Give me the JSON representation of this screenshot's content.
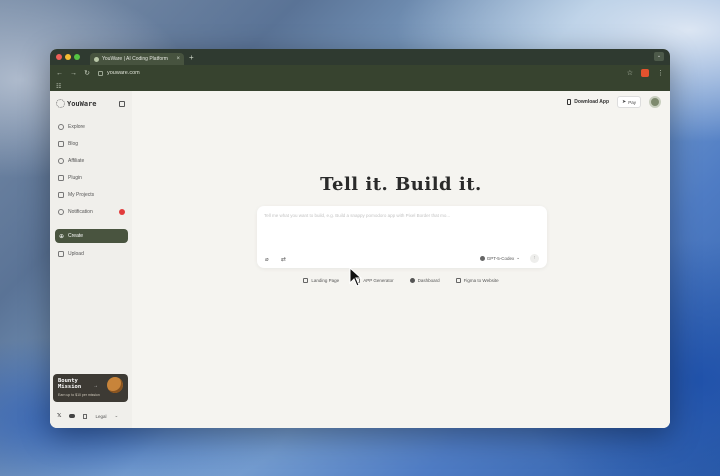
{
  "browser": {
    "tab_title": "YouWare | AI Coding Platform",
    "url": "youware.com"
  },
  "sidebar": {
    "brand": "YouWare",
    "items": [
      {
        "label": "Explore",
        "icon": "compass-icon"
      },
      {
        "label": "Blog",
        "icon": "book-icon"
      },
      {
        "label": "Affiliate",
        "icon": "people-icon"
      },
      {
        "label": "Plugin",
        "icon": "plugin-icon"
      },
      {
        "label": "My Projects",
        "icon": "folder-icon"
      },
      {
        "label": "Notification",
        "icon": "bell-icon"
      }
    ],
    "create_label": "Create",
    "upload_label": "Upload",
    "bounty": {
      "title": "Bounty Mission",
      "subtitle": "Earn up to $10 per mission"
    },
    "footer": {
      "legal_label": "Legal"
    }
  },
  "header": {
    "download_label": "Download App",
    "pay_label": "Pay"
  },
  "hero": {
    "headline": "Tell it. Build it.",
    "prompt_placeholder": "Tell me what you want to build, e.g. Build a snappy pomodoro app with Pixel Border that mo...",
    "model_label": "GPT-5-Codex"
  },
  "suggestions": [
    {
      "label": "Landing Page",
      "icon": "layout-icon"
    },
    {
      "label": "APP Generator",
      "icon": "app-icon"
    },
    {
      "label": "Dashboard",
      "icon": "dashboard-icon"
    },
    {
      "label": "Figma to Website",
      "icon": "figma-icon"
    }
  ],
  "colors": {
    "accent": "#49543f",
    "badge": "#e23b3b",
    "browser_chrome": "#37432f"
  }
}
